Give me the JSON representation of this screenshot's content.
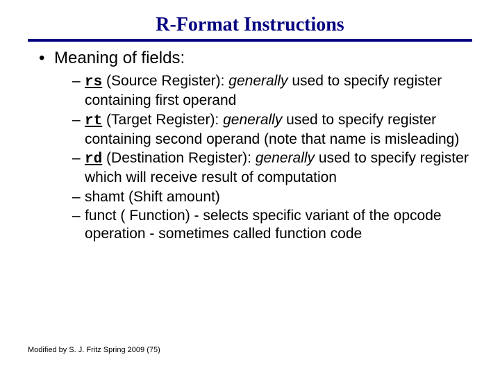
{
  "title": "R-Format Instructions",
  "mainBullet": "Meaning of fields:",
  "items": [
    {
      "code": "rs",
      "label": " (Source Register): ",
      "gen": "generally",
      "rest": " used to specify register containing first operand",
      "mono": true
    },
    {
      "code": "rt",
      "label": " (Target Register): ",
      "gen": "generally",
      "rest": " used to specify register containing second operand (note that name is misleading)",
      "mono": true
    },
    {
      "code": "rd",
      "label": " (Destination Register): ",
      "gen": "generally",
      "rest": " used to specify register which will receive result of computation",
      "mono": true
    },
    {
      "plain": "shamt (Shift amount)"
    },
    {
      "plain": "funct ( Function) - selects specific variant of the opcode operation - sometimes called function code"
    }
  ],
  "footer": "Modified by S. J. Fritz  Spring 2009 (75)"
}
